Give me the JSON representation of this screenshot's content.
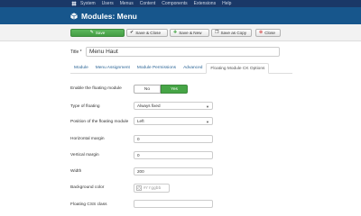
{
  "topnav": {
    "items": [
      "System",
      "Users",
      "Menus",
      "Content",
      "Components",
      "Extensions",
      "Help"
    ]
  },
  "header": {
    "title": "Modules: Menu",
    "icon": "cube-icon"
  },
  "toolbar": {
    "save": "Save",
    "save_close": "Save & Close",
    "save_new": "Save & New",
    "save_copy": "Save as Copy",
    "close": "Close"
  },
  "title_field": {
    "label": "Title *",
    "value": "Menu Haut"
  },
  "tabs": [
    "Module",
    "Menu Assignment",
    "Module Permissions",
    "Advanced",
    "Floating Module CK Options"
  ],
  "active_tab": "Floating Module CK Options",
  "form": {
    "enable": {
      "label": "Enable the floating module",
      "no": "No",
      "yes": "Yes",
      "selected": "Yes"
    },
    "type": {
      "label": "Type of floating",
      "value": "Always fixed"
    },
    "position": {
      "label": "Position of the floating module",
      "value": "Left"
    },
    "hmargin": {
      "label": "Horizontal margin",
      "value": "0"
    },
    "vmargin": {
      "label": "Vertical margin",
      "value": "0"
    },
    "width": {
      "label": "Width",
      "value": "200"
    },
    "bgcolor": {
      "label": "Background color",
      "value": "#rrggbb"
    },
    "cssclass": {
      "label": "Floating CSS class",
      "value": ""
    }
  },
  "colors": {
    "nav": "#1a3867",
    "header": "#17568c",
    "save": "#46a546",
    "link": "#2a6496"
  }
}
